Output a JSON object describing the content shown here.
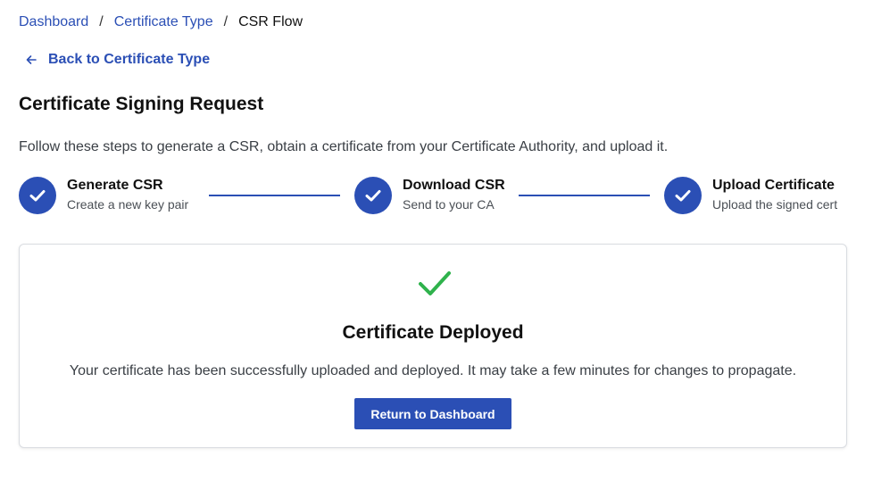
{
  "breadcrumb": {
    "items": [
      {
        "label": "Dashboard"
      },
      {
        "label": "Certificate Type"
      },
      {
        "label": "CSR Flow"
      }
    ],
    "separator": "/"
  },
  "back_link": {
    "label": "Back to Certificate Type",
    "icon": "arrow-left-icon"
  },
  "page": {
    "title": "Certificate Signing Request",
    "intro": "Follow these steps to generate a CSR, obtain a certificate from your Certificate Authority, and upload it."
  },
  "steps": [
    {
      "title": "Generate CSR",
      "subtitle": "Create a new key pair",
      "status": "complete",
      "icon": "check-icon"
    },
    {
      "title": "Download CSR",
      "subtitle": "Send to your CA",
      "status": "complete",
      "icon": "check-icon"
    },
    {
      "title": "Upload Certificate",
      "subtitle": "Upload the signed cert",
      "status": "complete",
      "icon": "check-icon"
    }
  ],
  "result": {
    "icon": "checkmark-icon",
    "title": "Certificate Deployed",
    "message": "Your certificate has been successfully uploaded and deployed. It may take a few minutes for changes to propagate.",
    "button_label": "Return to Dashboard"
  },
  "colors": {
    "primary": "#2b4fb5",
    "success": "#2fb24c",
    "border": "#d9dce1",
    "text": "#111111",
    "muted_text": "#3a3f45"
  }
}
